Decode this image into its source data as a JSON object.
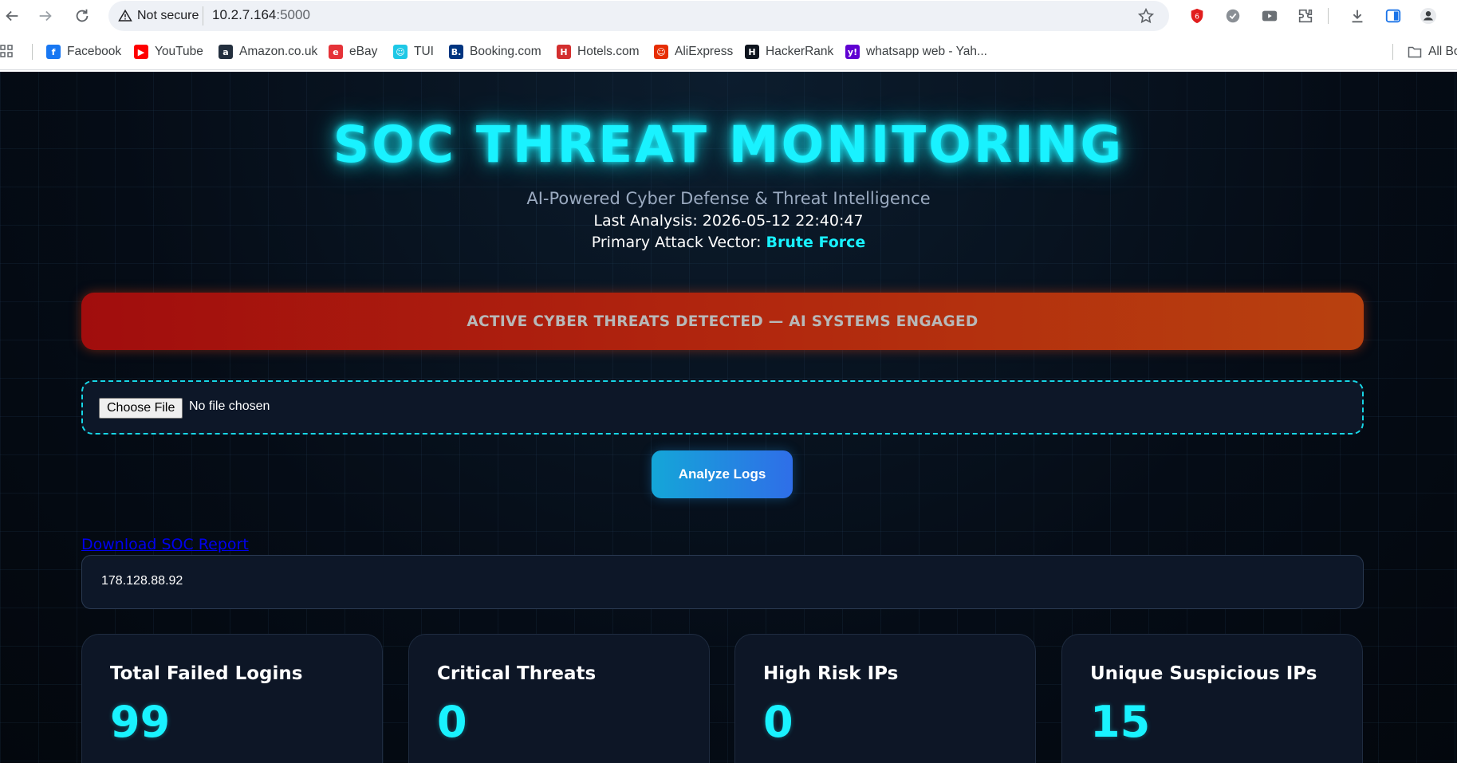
{
  "browser": {
    "security_label": "Not secure",
    "url_host": "10.2.7.164",
    "url_port": ":5000"
  },
  "bookmarks": [
    {
      "label": "Facebook",
      "icon": "facebook-icon",
      "color": "#1877f2",
      "glyph": "f"
    },
    {
      "label": "YouTube",
      "icon": "youtube-icon",
      "color": "#ff0000",
      "glyph": "▶"
    },
    {
      "label": "Amazon.co.uk",
      "icon": "amazon-icon",
      "color": "#232f3e",
      "glyph": "a"
    },
    {
      "label": "eBay",
      "icon": "ebay-icon",
      "color": "#e53238",
      "glyph": "e"
    },
    {
      "label": "TUI",
      "icon": "tui-icon",
      "color": "#1ec8e6",
      "glyph": "☺"
    },
    {
      "label": "Booking.com",
      "icon": "booking-icon",
      "color": "#003580",
      "glyph": "B."
    },
    {
      "label": "Hotels.com",
      "icon": "hotels-icon",
      "color": "#d32f2f",
      "glyph": "H"
    },
    {
      "label": "AliExpress",
      "icon": "aliexpress-icon",
      "color": "#e62e04",
      "glyph": "☺"
    },
    {
      "label": "HackerRank",
      "icon": "hackerrank-icon",
      "color": "#0e141e",
      "glyph": "H"
    },
    {
      "label": "whatsapp web - Yah...",
      "icon": "yahoo-icon",
      "color": "#6001d2",
      "glyph": "y!"
    }
  ],
  "bookmarks_all": "All Bo",
  "header": {
    "title": "SOC THREAT MONITORING",
    "subtitle": "AI-Powered Cyber Defense & Threat Intelligence",
    "last_analysis_label": "Last Analysis: ",
    "last_analysis_value": "2026-05-12 22:40:47",
    "attack_vector_label": "Primary Attack Vector: ",
    "attack_vector_value": "Brute Force"
  },
  "alert": {
    "text": "ACTIVE CYBER THREATS DETECTED — AI SYSTEMS ENGAGED"
  },
  "upload": {
    "button_label": "Choose File",
    "status": "No file chosen"
  },
  "analyze_button_label": "Analyze Logs",
  "download_link_label": "Download SOC Report",
  "ip_select": {
    "selected": "178.128.88.92"
  },
  "stats": [
    {
      "label": "Total Failed Logins",
      "value": "99"
    },
    {
      "label": "Critical Threats",
      "value": "0"
    },
    {
      "label": "High Risk IPs",
      "value": "0"
    },
    {
      "label": "Unique Suspicious IPs",
      "value": "15"
    }
  ],
  "colors": {
    "accent_cyan": "#19f2ff",
    "alert_red": "#a10d0d",
    "alert_orange": "#b8410f",
    "button_blue": "#2f6ee8",
    "page_bg": "#040b14"
  }
}
